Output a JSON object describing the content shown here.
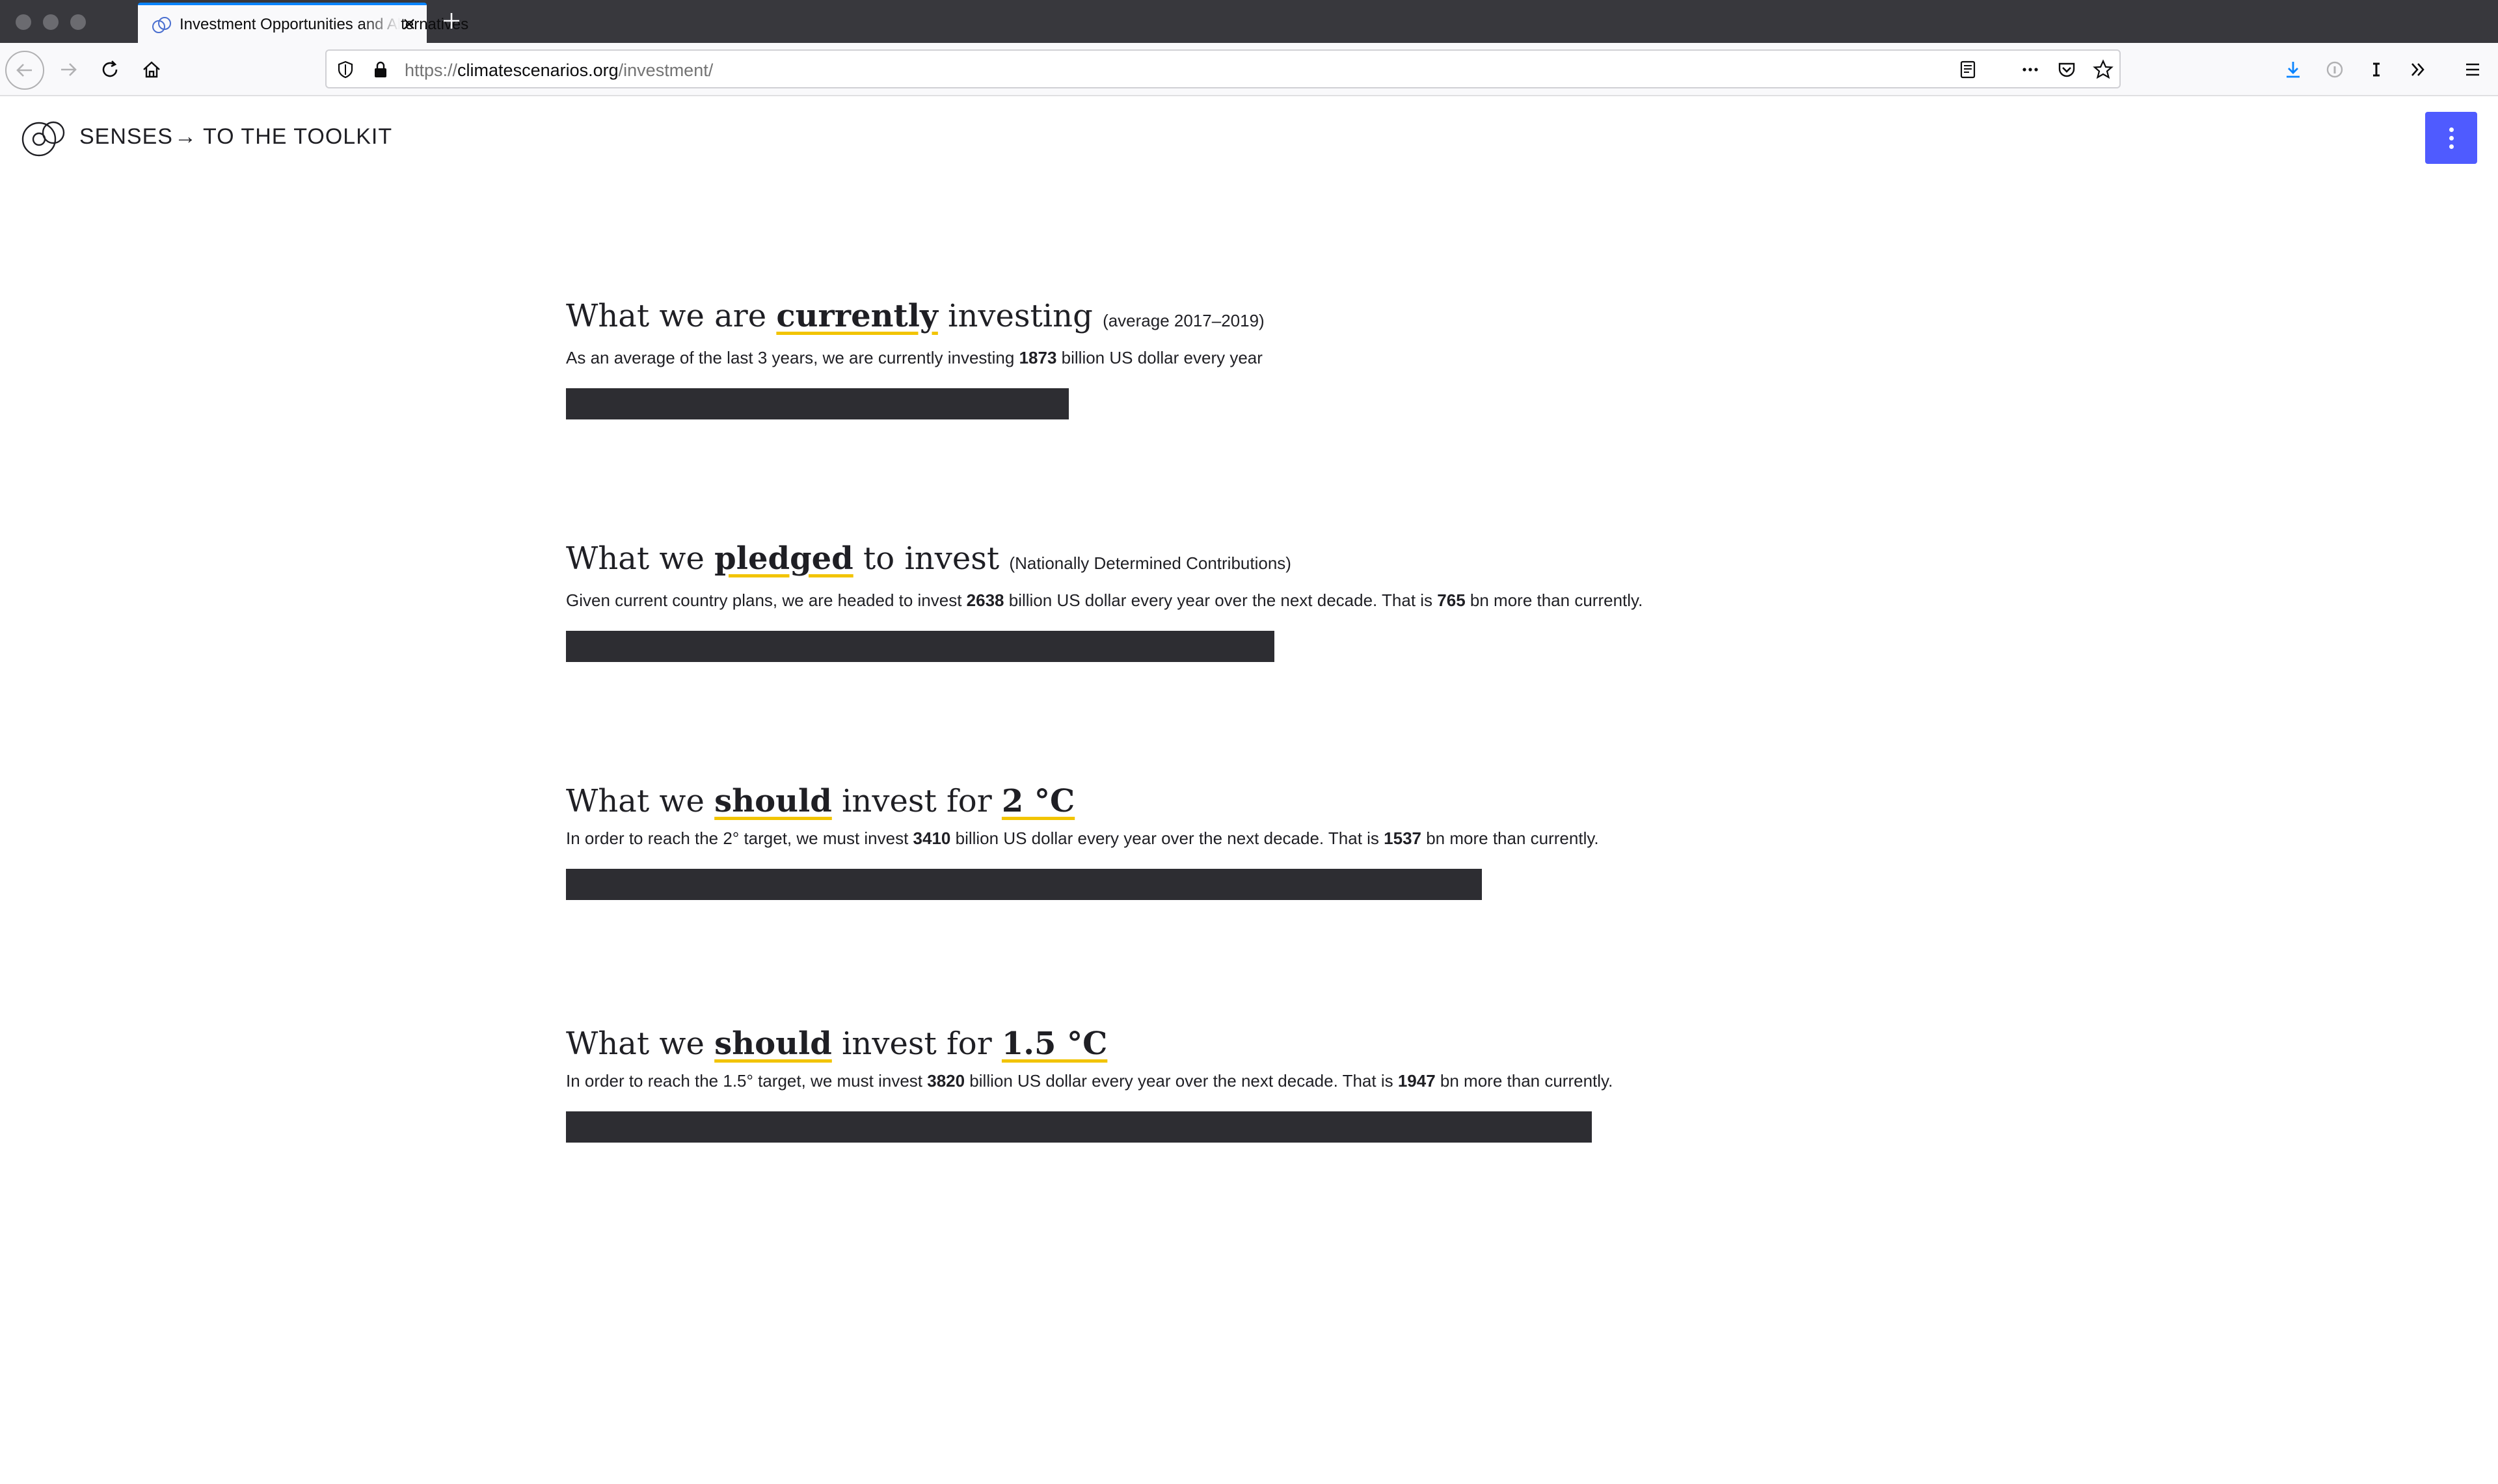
{
  "browser": {
    "tab_title": "Investment Opportunities and Alternatives",
    "url_prefix": "https://",
    "url_host": "climatescenarios.org",
    "url_path": "/investment/"
  },
  "header": {
    "brand": "SENSES",
    "arrow": "→",
    "toolkit_link": "TO THE TOOLKIT"
  },
  "sections": [
    {
      "title_pre": "What we are ",
      "title_hl": "currently",
      "title_post": " investing",
      "title_note": "(average 2017–2019)",
      "desc_pre": "As an average of the last 3 years, we are currently investing ",
      "value": "1873",
      "desc_mid": " billion US dollar every year",
      "diff": "",
      "desc_post": ""
    },
    {
      "title_pre": "What we ",
      "title_hl": "pledged",
      "title_post": " to invest",
      "title_note": "(Nationally Determined Contributions)",
      "desc_pre": "Given current country plans, we are headed to invest ",
      "value": "2638",
      "desc_mid": " billion US dollar every year over the next decade. That is ",
      "diff": "765",
      "desc_post": " bn more than currently."
    },
    {
      "title_pre": "What we ",
      "title_hl": "should",
      "title_post": " invest for ",
      "title_target": "2 °C",
      "desc_pre": "In order to reach the 2° target, we must invest ",
      "value": "3410",
      "desc_mid": " billion US dollar every year over the next decade. That is ",
      "diff": "1537",
      "desc_post": " bn more than currently."
    },
    {
      "title_pre": "What we ",
      "title_hl": "should",
      "title_post": " invest for ",
      "title_target": "1.5 °C",
      "desc_pre": "In order to reach the 1.5° target, we must invest ",
      "value": "3820",
      "desc_mid": " billion US dollar every year over the next decade. That is ",
      "diff": "1947",
      "desc_post": " bn more than currently."
    }
  ],
  "chart_data": {
    "type": "bar",
    "categories": [
      "currently investing",
      "pledged to invest",
      "should invest for 2 °C",
      "should invest for 1.5 °C"
    ],
    "values": [
      1873,
      2638,
      3410,
      3820
    ],
    "unit": "billion US dollar per year"
  },
  "colors": {
    "bar": "#2d2d32",
    "highlight_underline": "#f2c400",
    "menu_button": "#4f5bff",
    "tab_accent": "#0a84ff"
  }
}
